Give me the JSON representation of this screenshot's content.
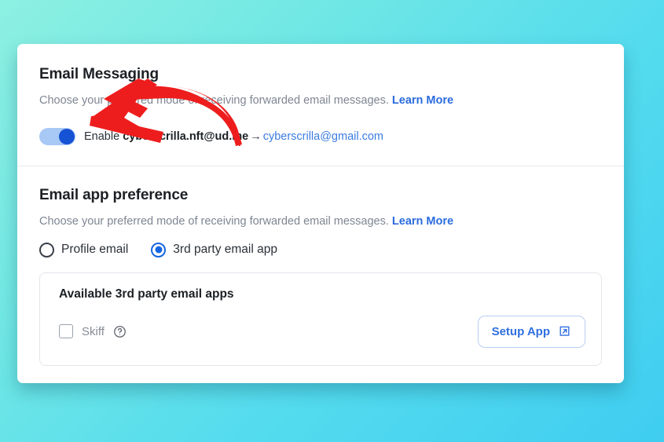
{
  "background": {
    "gradient_from": "#8df0e2",
    "gradient_to": "#3fcdf0"
  },
  "card": {
    "email_messaging": {
      "title": "Email Messaging",
      "description": "Choose your preferred mode of receiving forwarded email messages.",
      "learn_more_label": "Learn More",
      "toggle": {
        "state": "on",
        "enable_label": "Enable",
        "source_address": "cyberscrilla.nft@ud.me",
        "arrow_glyph": "→",
        "destination_address": "cyberscrilla@gmail.com",
        "track_color": "#a8c8f5",
        "knob_color": "#1652d4"
      }
    },
    "email_app_preference": {
      "title": "Email app preference",
      "description": "Choose your preferred mode of receiving forwarded email messages.",
      "learn_more_label": "Learn More",
      "options": [
        {
          "label": "Profile email",
          "selected": false
        },
        {
          "label": "3rd party email app",
          "selected": true
        }
      ],
      "apps_panel": {
        "title": "Available 3rd party email apps",
        "apps": [
          {
            "name": "Skiff",
            "checked": false,
            "help_icon": "question-circle-icon"
          }
        ],
        "setup_button": {
          "label": "Setup App",
          "icon": "external-link-icon",
          "color": "#2f6fe0"
        }
      }
    }
  },
  "annotation": {
    "arrow": {
      "name": "red-arrow-annotation",
      "color": "#ee1d1d",
      "points_to": "enable-toggle"
    }
  }
}
